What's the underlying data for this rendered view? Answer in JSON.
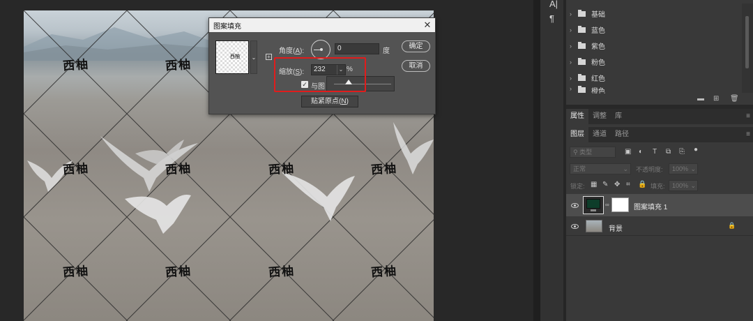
{
  "dialog": {
    "title": "图案填充",
    "close_glyph": "✕",
    "angle_label": "角度(",
    "angle_key": "A",
    "angle_suffix": "):",
    "angle_value": "0",
    "angle_unit": "度",
    "scale_label": "缩放(",
    "scale_key": "S",
    "scale_suffix": "):",
    "scale_value": "232",
    "scale_unit": "%",
    "link_label": "与图",
    "slider_level": 0.25,
    "snap_label": "贴紧原点(",
    "snap_key": "N",
    "snap_suffix": ")",
    "ok_label": "确定",
    "cancel_label": "取消",
    "swatch_text": "西柚"
  },
  "canvas": {
    "watermark": "西柚"
  },
  "tool_strip": {
    "icons": [
      "character-icon",
      "paragraph-icon"
    ],
    "glyphs": [
      "A|",
      "¶"
    ]
  },
  "swatches": {
    "folders": [
      {
        "label": "基础"
      },
      {
        "label": "蓝色"
      },
      {
        "label": "紫色"
      },
      {
        "label": "粉色"
      },
      {
        "label": "红色"
      },
      {
        "label": "橙色"
      }
    ]
  },
  "properties_tabs": {
    "tabs": [
      "属性",
      "调整",
      "库"
    ]
  },
  "layers_tabs": {
    "tabs": [
      "图层",
      "通道",
      "路径"
    ]
  },
  "layers": {
    "filter_placeholder": "类型",
    "blend_mode": "正常",
    "opacity_label": "不透明度:",
    "opacity_value": "100%",
    "lock_label": "锁定:",
    "fill_label": "填充:",
    "fill_value": "100%",
    "items": [
      {
        "name": "图案填充 1",
        "selected": true
      },
      {
        "name": "背景",
        "selected": false
      }
    ]
  },
  "colors": {
    "highlight": "#e11c1c",
    "panel_bg": "#393939",
    "selected_row": "#4d4d4d"
  }
}
